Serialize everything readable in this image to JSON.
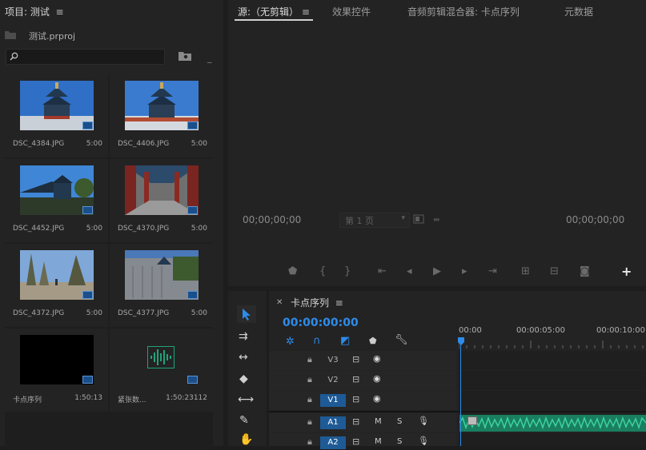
{
  "project": {
    "title": "项目: 测试",
    "file": "测试.prproj",
    "items": [
      {
        "name": "DSC_4384.JPG",
        "duration": "5:00"
      },
      {
        "name": "DSC_4406.JPG",
        "duration": "5:00"
      },
      {
        "name": "DSC_4452.JPG",
        "duration": "5:00"
      },
      {
        "name": "DSC_4370.JPG",
        "duration": "5:00"
      },
      {
        "name": "DSC_4372.JPG",
        "duration": "5:00"
      },
      {
        "name": "DSC_4377.JPG",
        "duration": "5:00"
      },
      {
        "name": "卡点序列",
        "duration": "1:50:13"
      },
      {
        "name": "紧张数...",
        "duration": "1:50:23112"
      }
    ]
  },
  "source": {
    "tabs": [
      "源:（无剪辑）",
      "效果控件",
      "音频剪辑混合器: 卡点序列",
      "元数据"
    ],
    "timecode_left": "00;00;00;00",
    "timecode_right": "00;00;00;00",
    "page_label": "第 1 页"
  },
  "timeline": {
    "sequence_name": "卡点序列",
    "timecode": "00:00:00:00",
    "ruler": [
      "00:00",
      "00:00:05:00",
      "00:00:10:00"
    ],
    "video_tracks": [
      "V3",
      "V2",
      "V1"
    ],
    "audio_tracks": [
      "A1",
      "A2"
    ],
    "mute_label": "M",
    "solo_label": "S"
  },
  "colors": {
    "accent": "#2d8ceb",
    "audio_clip": "#1fa37a",
    "panel_bg": "#232323"
  }
}
